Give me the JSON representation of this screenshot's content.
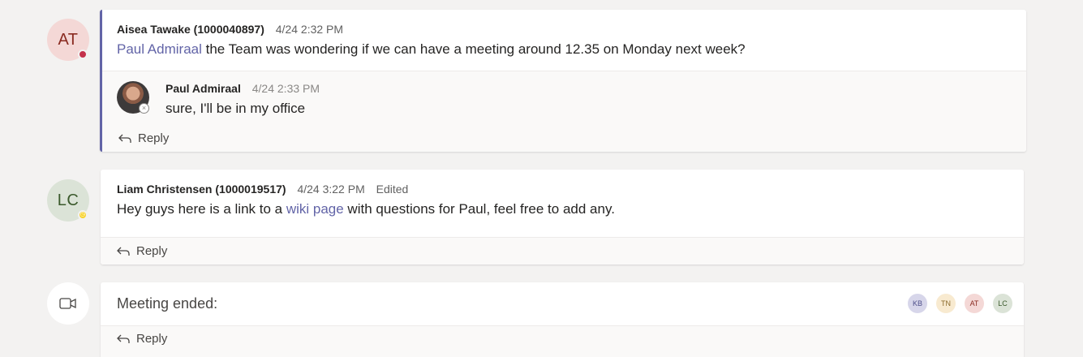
{
  "thread1": {
    "avatar_initials": "AT",
    "author": "Aisea Tawake (1000040897)",
    "time": "4/24 2:32 PM",
    "mention": "Paul Admiraal",
    "text": " the Team was wondering if we can have a meeting around 12.35 on Monday next week?",
    "reply": {
      "author": "Paul Admiraal",
      "time": "4/24 2:33 PM",
      "text": "sure, I'll be in my office"
    },
    "reply_label": "Reply"
  },
  "thread2": {
    "avatar_initials": "LC",
    "author": "Liam Christensen (1000019517)",
    "time": "4/24 3:22 PM",
    "edited": "Edited",
    "text_before": "Hey guys here is a link to a ",
    "link_text": "wiki page",
    "text_after": " with questions for Paul, feel free to add any.",
    "reply_label": "Reply"
  },
  "thread3": {
    "title": "Meeting ended:",
    "participants": [
      "KB",
      "TN",
      "AT",
      "LC"
    ],
    "reply_label": "Reply"
  },
  "colors": {
    "accent": "#6264a7",
    "busy": "#c4314b",
    "away": "#f8d22a"
  },
  "icons": {
    "reply": "reply-arrow-icon",
    "meeting": "video-camera-icon",
    "presence_offline": "offline-x-icon"
  }
}
